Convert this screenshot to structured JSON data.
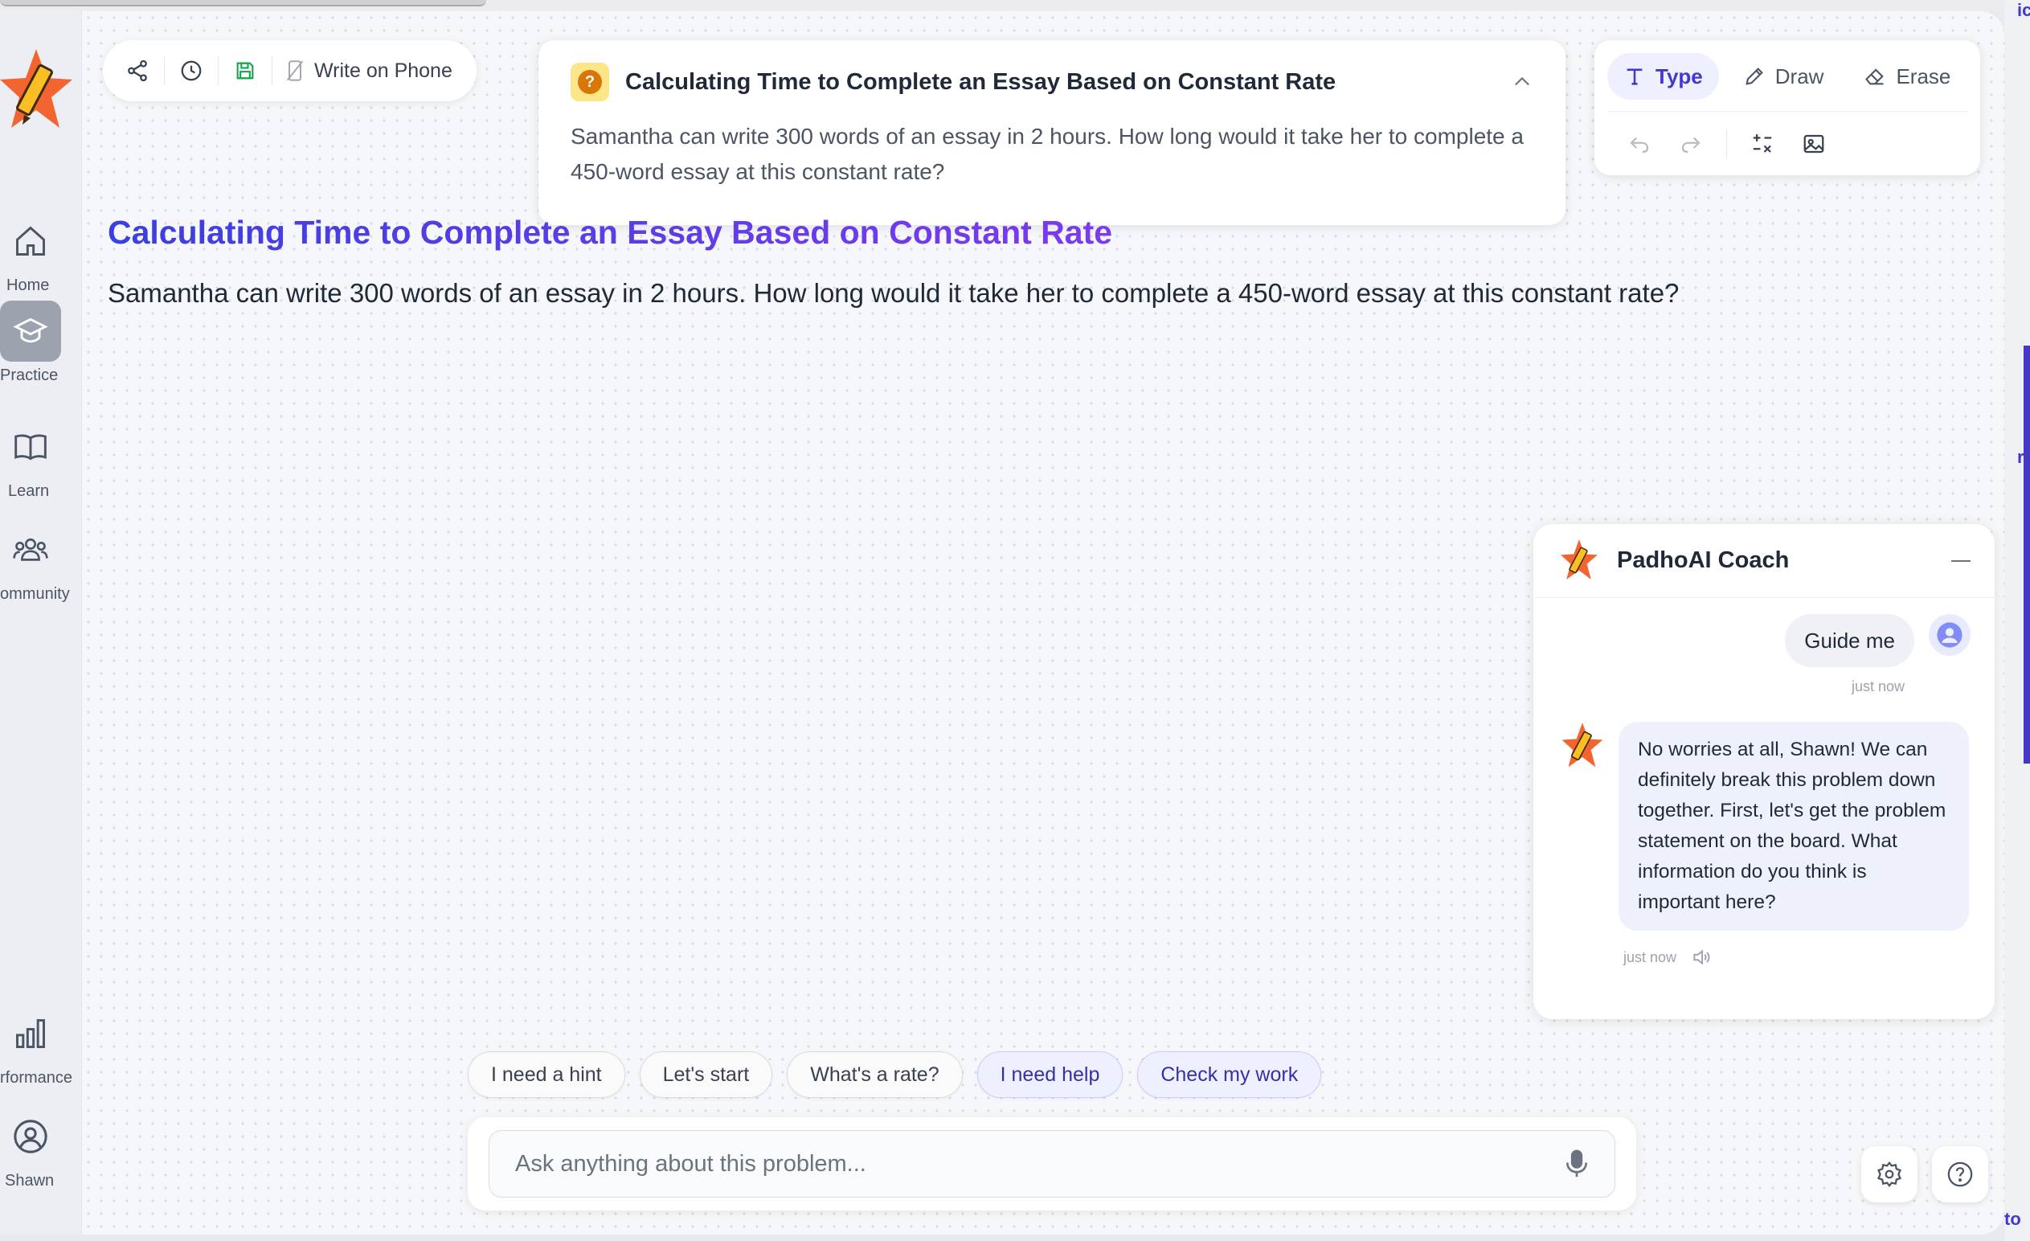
{
  "sidebar": {
    "items": [
      {
        "label": "Home",
        "icon": "home-icon"
      },
      {
        "label": "Practice",
        "icon": "graduation-cap-icon",
        "active": true
      },
      {
        "label": "Learn",
        "icon": "book-icon"
      },
      {
        "label": "ommunity",
        "icon": "users-icon"
      },
      {
        "label": "rformance",
        "icon": "bar-chart-icon"
      },
      {
        "label": "Shawn",
        "icon": "user-circle-icon"
      }
    ]
  },
  "toolbar": {
    "write_on_phone": "Write on Phone"
  },
  "problem": {
    "title": "Calculating Time to Complete an Essay Based on Constant Rate",
    "text": "Samantha can write 300 words of an essay in 2 hours. How long would it take her to complete a 450-word essay at this constant rate?"
  },
  "tools": {
    "type": "Type",
    "draw": "Draw",
    "erase": "Erase"
  },
  "canvas": {
    "title": "Calculating Time to Complete an Essay Based on Constant Rate",
    "text": "Samantha can write 300 words of an essay in 2 hours. How long would it take her to complete a 450-word essay at this constant rate?"
  },
  "coach": {
    "name": "PadhoAI Coach",
    "user_message": "Guide me",
    "user_time": "just now",
    "bot_message": "No worries at all, Shawn! We can definitely break this problem down together. First, let's get the problem statement on the board. What information do you think is important here?",
    "bot_time": "just now"
  },
  "chips": [
    "I need a hint",
    "Let's start",
    "What's a rate?",
    "I need help",
    "Check my work"
  ],
  "ask": {
    "placeholder": "Ask anything about this problem..."
  },
  "edge_fragments": [
    "ic",
    "r",
    "to"
  ],
  "colors": {
    "accent": "#4338ca",
    "title_gradient_start": "#3b3fe0",
    "title_gradient_end": "#7c3aed",
    "logo_star": "#f26430"
  }
}
